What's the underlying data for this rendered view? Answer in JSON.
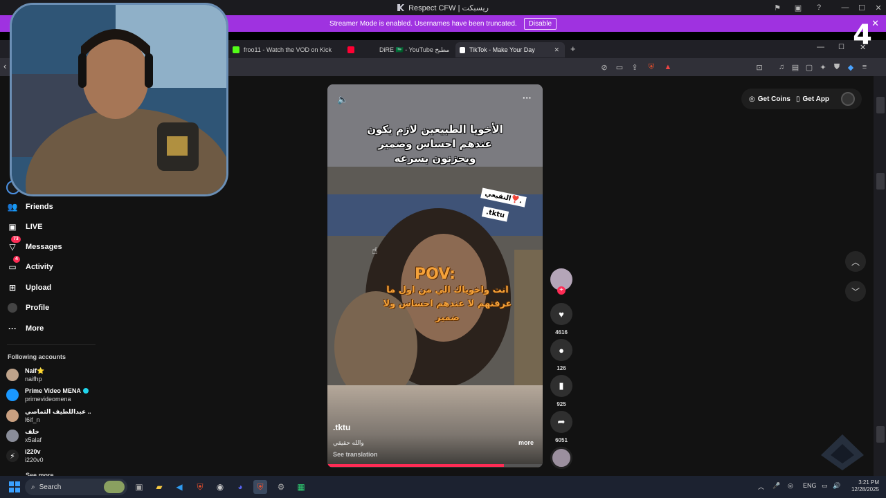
{
  "outer_window": {
    "title": "Respect CFW | ريسبكت"
  },
  "streamer_bar": {
    "message": "Streamer Mode is enabled. Usernames have been truncated.",
    "disable_label": "Disable",
    "close_icon": "✕"
  },
  "overlay_number": "4",
  "tabs": [
    {
      "label": "froo11 - Watch the VOD on Kick",
      "icon_color": "#53fc18"
    },
    {
      "label": "DiRE 🇸🇦 - YouTube مطبخ",
      "icon_color": "#ff0033"
    },
    {
      "label": "TikTok - Make Your Day",
      "icon_color": "#ffffff",
      "active": true
    }
  ],
  "new_tab_label": "+",
  "sidebar": {
    "items": [
      {
        "label": "Friends",
        "icon": "friends-icon"
      },
      {
        "label": "LIVE",
        "icon": "live-icon"
      },
      {
        "label": "Messages",
        "icon": "messages-icon",
        "badge": "73"
      },
      {
        "label": "Activity",
        "icon": "activity-icon",
        "badge": "4"
      },
      {
        "label": "Upload",
        "icon": "upload-icon"
      },
      {
        "label": "Profile",
        "icon": "profile-icon"
      },
      {
        "label": "More",
        "icon": "more-icon"
      }
    ],
    "following_title": "Following accounts",
    "accounts": [
      {
        "name": "Naif⭐",
        "handle": "naifhp",
        "color": "#bfa38a"
      },
      {
        "name": "Prime Video MENA",
        "handle": "primevideomena",
        "verified": true,
        "color": "#1a98ff"
      },
      {
        "name": "عبداللطيف التماصي ..",
        "handle": "l6if_n",
        "color": "#caa080"
      },
      {
        "name": "خلف",
        "handle": "x5alaf",
        "color": "#8a8d99"
      },
      {
        "name": "i220v",
        "handle": "i220v0",
        "color": "#222"
      }
    ],
    "see_more": "See more"
  },
  "top_right": {
    "coins_label": "Get Coins",
    "app_label": "Get App"
  },
  "video": {
    "caption_lines": [
      "الأخويا الطبيعين لازم يكون",
      "عندهم احساس وضمير",
      "ويحزنون بسرعه"
    ],
    "sticker_1": "النفيعي❣️.",
    "sticker_2": ".tktu",
    "pov_title": "POV:",
    "pov_lines": [
      "انت واخوياك الي من اول ما",
      "عرفتهم لا عندهم احساس ولا",
      "ضمير"
    ],
    "author": ".tktu",
    "description": "والله حقيقي",
    "more_label": "more",
    "see_translation": "See translation",
    "progress": 0.82
  },
  "actions": {
    "likes": "4616",
    "comments": "126",
    "saves": "925",
    "shares": "6051"
  },
  "taskbar": {
    "search_label": "Search",
    "lang": "ENG",
    "time": "3:21 PM",
    "date": "12/28/2025"
  }
}
